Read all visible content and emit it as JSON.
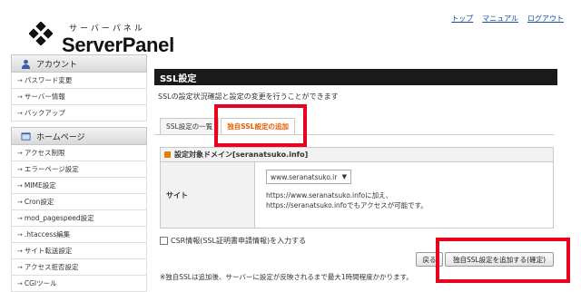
{
  "header": {
    "logo_kana": "サーバーパネル",
    "logo_text": "ServerPanel",
    "links": [
      "トップ",
      "マニュアル",
      "ログアウト"
    ]
  },
  "sidebar": {
    "sections": [
      {
        "title": "アカウント",
        "icon": "user-icon",
        "items": [
          "パスワード変更",
          "サーバー情報",
          "バックアップ"
        ]
      },
      {
        "title": "ホームページ",
        "icon": "home-page-icon",
        "items": [
          "アクセス制限",
          "エラーページ設定",
          "MIME設定",
          "Cron設定",
          "mod_pagespeed設定",
          ".htaccess編集",
          "サイト転送設定",
          "アクセス拒否設定",
          "CGIツール"
        ]
      }
    ]
  },
  "main": {
    "title": "SSL設定",
    "description": "SSLの設定状況確認と設定の変更を行うことができます",
    "tabs": [
      "SSL設定の一覧",
      "独自SSL設定の追加"
    ],
    "panel_title": "設定対象ドメイン[seranatsuko.info]",
    "site_label": "サイト",
    "site_select_value": "www.seranatsuko.ir",
    "note_line1": "https://www.seranatsuko.infoに加え、",
    "note_line2": "https://seranatsuko.infoでもアクセスが可能です。",
    "csr_label": "CSR情報(SSL証明書申請情報)を入力する",
    "back_button": "戻る",
    "add_button": "独自SSL設定を追加する(確定)",
    "footer_note": "※独自SSLは追加後、サーバーに設定が反映されるまで最大1時間程度かかります。"
  },
  "colors": {
    "highlight": "#e8001c",
    "active_tab_text": "#e55c00",
    "title_bar": "#1a1a1a",
    "link": "#1a4fa0"
  }
}
